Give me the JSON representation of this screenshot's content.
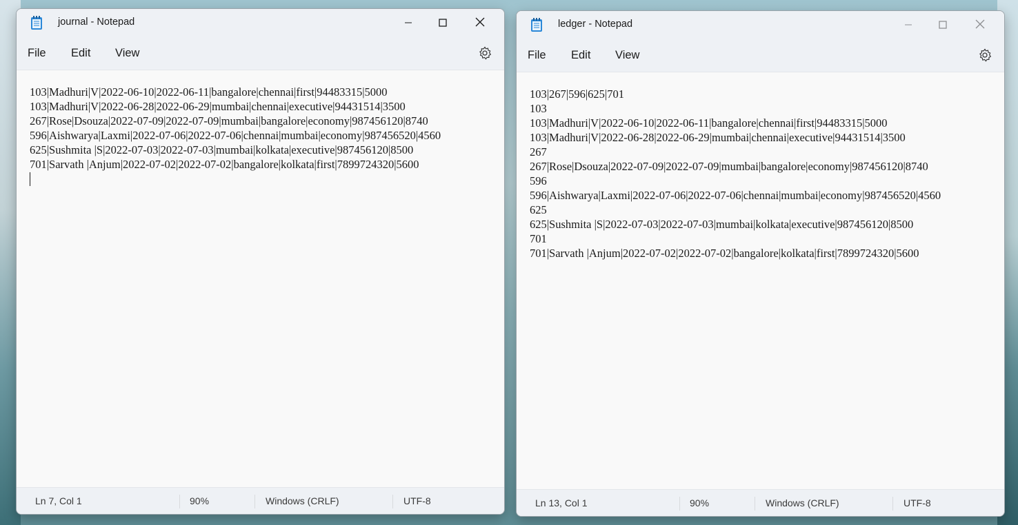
{
  "windows": {
    "journal": {
      "title": "journal - Notepad",
      "menu": {
        "file": "File",
        "edit": "Edit",
        "view": "View"
      },
      "lines": [
        "103|Madhuri|V|2022-06-10|2022-06-11|bangalore|chennai|first|94483315|5000",
        "103|Madhuri|V|2022-06-28|2022-06-29|mumbai|chennai|executive|94431514|3500",
        "267|Rose|Dsouza|2022-07-09|2022-07-09|mumbai|bangalore|economy|987456120|8740",
        "596|Aishwarya|Laxmi|2022-07-06|2022-07-06|chennai|mumbai|economy|987456520|4560",
        "625|Sushmita |S|2022-07-03|2022-07-03|mumbai|kolkata|executive|987456120|8500",
        "701|Sarvath |Anjum|2022-07-02|2022-07-02|bangalore|kolkata|first|7899724320|5600"
      ],
      "status": {
        "position": "Ln 7, Col 1",
        "zoom": "90%",
        "line_ending": "Windows (CRLF)",
        "encoding": "UTF-8"
      }
    },
    "ledger": {
      "title": "ledger - Notepad",
      "menu": {
        "file": "File",
        "edit": "Edit",
        "view": "View"
      },
      "lines": [
        "103|267|596|625|701",
        "103",
        "103|Madhuri|V|2022-06-10|2022-06-11|bangalore|chennai|first|94483315|5000",
        "103|Madhuri|V|2022-06-28|2022-06-29|mumbai|chennai|executive|94431514|3500",
        "267",
        "267|Rose|Dsouza|2022-07-09|2022-07-09|mumbai|bangalore|economy|987456120|8740",
        "596",
        "596|Aishwarya|Laxmi|2022-07-06|2022-07-06|chennai|mumbai|economy|987456520|4560",
        "625",
        "625|Sushmita |S|2022-07-03|2022-07-03|mumbai|kolkata|executive|987456120|8500",
        "701",
        "701|Sarvath |Anjum|2022-07-02|2022-07-02|bangalore|kolkata|first|7899724320|5600"
      ],
      "status": {
        "position": "Ln 13, Col 1",
        "zoom": "90%",
        "line_ending": "Windows (CRLF)",
        "encoding": "UTF-8"
      }
    }
  },
  "icons": {
    "app": "notepad-icon",
    "settings": "gear-icon",
    "minimize": "minimize-icon",
    "maximize": "maximize-icon",
    "close": "close-icon"
  },
  "colors": {
    "titlebar": "#eef1f5",
    "editor_bg": "#f9f9f9",
    "text": "#1b1b1b",
    "icon_blue": "#2b88d8"
  }
}
